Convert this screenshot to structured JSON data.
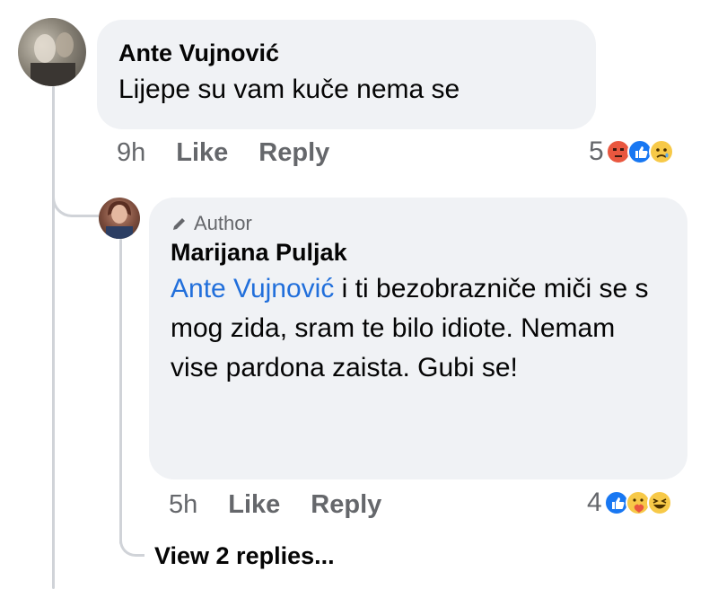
{
  "comment": {
    "author": "Ante Vujnović",
    "text": "Lijepe su vam kuče nema se",
    "time": "9h",
    "like_label": "Like",
    "reply_label": "Reply",
    "reaction_count": "5",
    "reactions": [
      "angry-icon",
      "like-icon",
      "sad-icon"
    ]
  },
  "reply": {
    "badge": "Author",
    "author": "Marijana Puljak",
    "mention": "Ante Vujnović",
    "text": " i ti bezobrazniče miči se s mog zida, sram te bilo idiote. Nemam vise pardona zaista. Gubi se!",
    "time": "5h",
    "like_label": "Like",
    "reply_label": "Reply",
    "reaction_count": "4",
    "reactions": [
      "like-icon",
      "care-icon",
      "haha-icon"
    ]
  },
  "view_replies": "View 2 replies...",
  "colors": {
    "bubble": "#f0f2f5",
    "mention": "#216fdb",
    "secondary_text": "#65676b",
    "like_blue": "#1877f2",
    "angry_red": "#e9573f",
    "emoji_yellow": "#f7c948"
  }
}
